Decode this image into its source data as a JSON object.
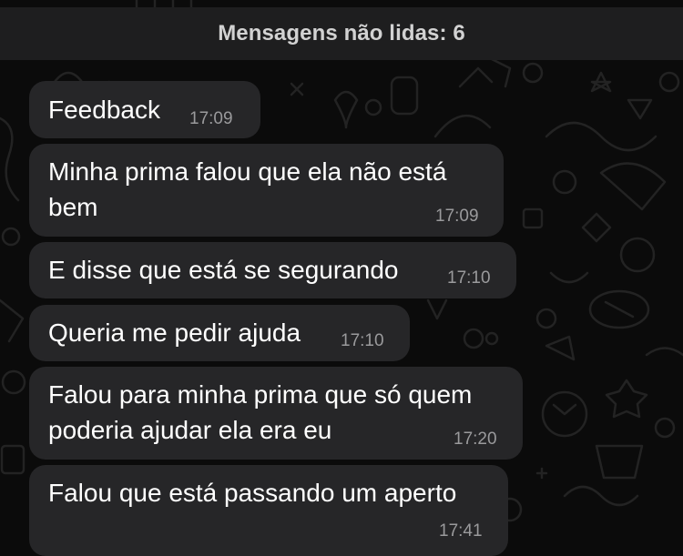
{
  "unread_banner": {
    "text": "Mensagens não lidas: 6"
  },
  "messages": [
    {
      "lines": [
        "Feedback"
      ],
      "time": "17:09"
    },
    {
      "lines": [
        "Minha prima falou que ela não está",
        "bem"
      ],
      "time": "17:09"
    },
    {
      "lines": [
        "E disse que está se segurando"
      ],
      "time": "17:10"
    },
    {
      "lines": [
        "Queria me pedir ajuda"
      ],
      "time": "17:10"
    },
    {
      "lines": [
        "Falou para minha prima que só quem",
        "poderia ajudar ela era eu"
      ],
      "time": "17:20"
    },
    {
      "lines": [
        "Falou que está passando um aperto"
      ],
      "time": "17:41"
    }
  ]
}
